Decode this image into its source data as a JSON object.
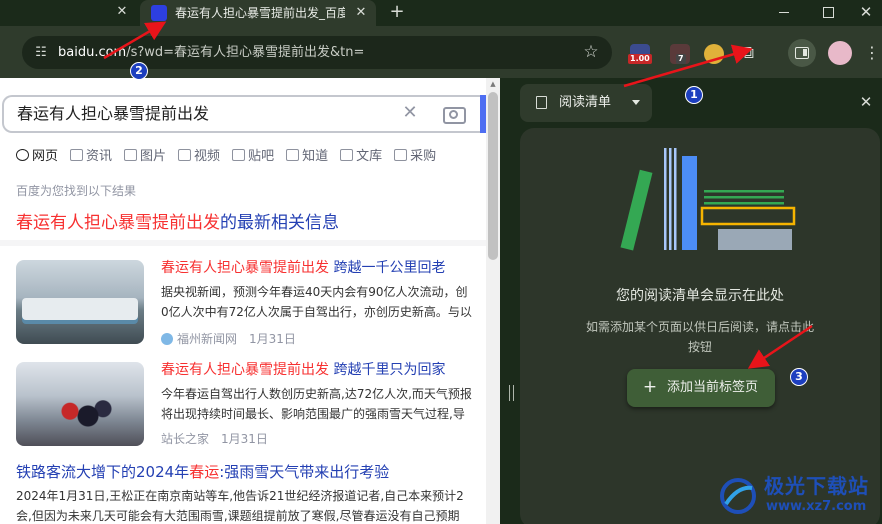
{
  "browser": {
    "tab_title": "春运有人担心暴雪提前出发_百度",
    "url_host": "baidu.com",
    "url_rest": "/s?wd=春运有人担心暴雪提前出发&tn=",
    "extension_badges": [
      "1.00",
      "7"
    ],
    "colors": {
      "frame": "#1b2a1a",
      "toolbar": "#2f3b2c",
      "accent_blue": "#4e6ef2"
    }
  },
  "webpage": {
    "search_query": "春运有人担心暴雪提前出发",
    "tabs": [
      "网页",
      "资讯",
      "图片",
      "视频",
      "贴吧",
      "知道",
      "文库",
      "采购"
    ],
    "result_count": "百度为您找到以下结果",
    "headline": {
      "highlight": "春运有人担心暴雪提前出发",
      "rest": "的最新相关信息"
    },
    "news": [
      {
        "title_highlight": "春运有人担心暴雪提前出发",
        "title_rest": " 跨越一千公里回老",
        "snippet_1": "据央视新闻，预测今年春运40天内会有90亿人次流动，创",
        "snippet_2": "0亿人次中有72亿人次属于自驾出行，亦创历史新高。与以",
        "source": "福州新闻网",
        "date": "1月31日"
      },
      {
        "title_highlight": "春运有人担心暴雪提前出发",
        "title_rest": " 跨越千里只为回家",
        "snippet_1": "今年春运自驾出行人数创历史新高,达72亿人次,而天气预报",
        "snippet_2": "将出现持续时间最长、影响范围最广的强雨雪天气过程,导",
        "source": "站长之家",
        "date": "1月31日"
      }
    ],
    "article": {
      "title_prefix": "铁路客流大增下的2024年",
      "title_highlight": "春运",
      "title_suffix": ":强雨雪天气带来出行考验",
      "snippet_1": "2024年1月31日,王松正在南京南站等车,他告诉21世纪经济报道记者,自己本来预计2",
      "snippet_2": "会,但因为未来几天可能会有大范围雨雪,课题组提前放了寒假,尽管春运没有自己预期"
    },
    "colors": {
      "link": "#2440b3",
      "highlight": "#f73131"
    }
  },
  "side_panel": {
    "dropdown_label": "阅读清单",
    "empty_title": "您的阅读清单会显示在此处",
    "empty_desc": "如需添加某个页面以供日后阅读，请点击此按钮",
    "add_button": "添加当前标签页",
    "colors": {
      "card": "#2d362a",
      "button": "#3f5e37"
    }
  },
  "annotations": {
    "steps": [
      "1",
      "2",
      "3"
    ],
    "arrow_color": "#e8141a",
    "badge_color": "#1d3fbf"
  },
  "watermark": {
    "name": "极光下载站",
    "url": "www.xz7.com"
  }
}
